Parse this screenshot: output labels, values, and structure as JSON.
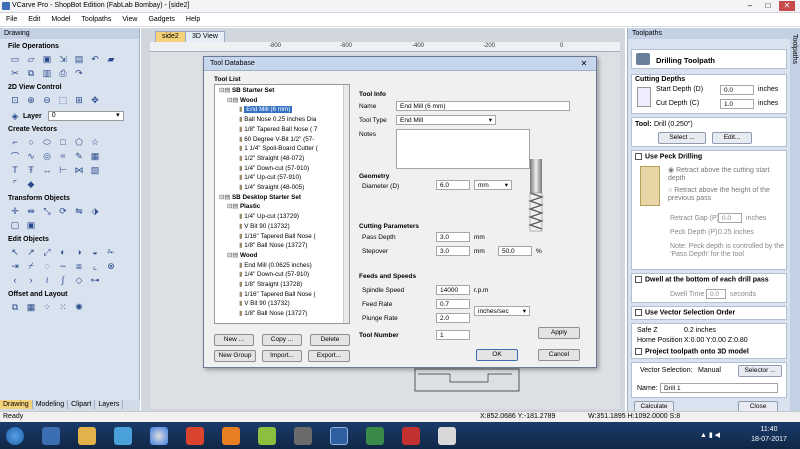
{
  "window": {
    "title": "VCarve Pro - ShopBot Edition (FabLab Bombay) - [side2]"
  },
  "menu": [
    "File",
    "Edit",
    "Model",
    "Toolpaths",
    "View",
    "Gadgets",
    "Help"
  ],
  "left_panel": {
    "header": "Drawing",
    "sections": {
      "file_ops": "File Operations",
      "view_control": "2D View Control",
      "layer_label": "Layer",
      "layer_value": "0",
      "create_vectors": "Create Vectors",
      "transform": "Transform Objects",
      "edit_objects": "Edit Objects",
      "offset": "Offset and Layout"
    },
    "tabs": [
      "Drawing",
      "Modeling",
      "Clipart",
      "Layers"
    ]
  },
  "doc_tabs": [
    "side2",
    "3D View"
  ],
  "ruler": [
    "-800",
    "-600",
    "-400",
    "-200",
    "0"
  ],
  "dialog": {
    "title": "Tool Database",
    "tool_list_label": "Tool List",
    "tree": [
      {
        "t": "SB Starter Set",
        "bold": true
      },
      {
        "t": "Wood",
        "bold": true
      },
      {
        "t": "End Mill (6 mm)",
        "sel": true
      },
      {
        "t": "Ball Nose 0.25 inches Dia"
      },
      {
        "t": "1/8\" Tapered Ball Nose ( 7"
      },
      {
        "t": "60 Degree V-Bit 1/2\" (57-"
      },
      {
        "t": "1 1/4\" Spoil-Board Cutter ("
      },
      {
        "t": "1/2\" Straight  (48-072)"
      },
      {
        "t": "1/4\" Down-cut (57-910)"
      },
      {
        "t": "1/4\" Up-cut (57-910)"
      },
      {
        "t": "1/4\" Straight (48-005)"
      },
      {
        "t": "SB Desktop Starter Set",
        "bold": true
      },
      {
        "t": "Plastic",
        "bold": true
      },
      {
        "t": "1/4\" Up-cut (13729)"
      },
      {
        "t": "V Bit 90 (13732)"
      },
      {
        "t": "1/16\" Tapered Ball Nose ("
      },
      {
        "t": "1/8\" Ball Nose (13727)"
      },
      {
        "t": "Wood",
        "bold": true
      },
      {
        "t": "End Mill (0.0625 inches)"
      },
      {
        "t": "1/4\" Down-cut (57-910)"
      },
      {
        "t": "1/8\" Straight (13728)"
      },
      {
        "t": "1/16\" Tapered Ball Nose ("
      },
      {
        "t": "V Bit 90 (13732)"
      },
      {
        "t": "1/8\" Ball Nose (13727)"
      }
    ],
    "buttons": {
      "new": "New ...",
      "copy": "Copy ...",
      "delete": "Delete",
      "new_group": "New Group",
      "import": "Import...",
      "export": "Export...",
      "apply": "Apply",
      "ok": "OK",
      "cancel": "Cancel"
    },
    "tool_info": {
      "header": "Tool Info",
      "name_label": "Name",
      "name": "End Mill (6 mm)",
      "type_label": "Tool Type",
      "type": "End Mill",
      "notes_label": "Notes"
    },
    "geometry": {
      "header": "Geometry",
      "diameter_label": "Diameter (D)",
      "diameter": "6.0",
      "unit": "mm"
    },
    "cutting": {
      "header": "Cutting Parameters",
      "pass_depth_label": "Pass Depth",
      "pass_depth": "3.0",
      "stepover_label": "Stepover",
      "stepover": "3.0",
      "stepover_pct": "50.0",
      "mm": "mm",
      "pct": "%"
    },
    "feeds": {
      "header": "Feeds and Speeds",
      "spindle_label": "Spindle Speed",
      "spindle": "14000",
      "rpm": "r.p.m",
      "feed_label": "Feed Rate",
      "feed": "0.7",
      "plunge_label": "Plunge Rate",
      "plunge": "2.0",
      "rate_unit": "inches/sec",
      "tool_number_label": "Tool Number",
      "tool_number": "1"
    }
  },
  "right_panel": {
    "header": "Toolpaths",
    "title": "Drilling Toolpath",
    "cutting_depths": "Cutting Depths",
    "start_depth_label": "Start Depth (D)",
    "start_depth": "0.0",
    "end_depth_label": "Cut Depth (C)",
    "cut_depth": "1.0",
    "units": "inches",
    "tool_label": "Tool:",
    "tool_value": "Drill (0.250\")",
    "select": "Select ...",
    "edit": "Edit...",
    "peck": "Use Peck Drilling",
    "retract1": "Retract above the cutting start depth",
    "retract2": "Retract above the height of the previous pass",
    "retract_gap_label": "Retract Gap (P)",
    "retract_gap": "0.0",
    "peck_depth_label": "Peck Depth (P)",
    "peck_depth": "0.25 inches",
    "note": "Note: Peck depth is controlled by the 'Pass Depth' for the tool",
    "dwell": "Dwell at the bottom of each drill pass",
    "dwell_time_label": "Dwell Time",
    "dwell_time": "0.0",
    "seconds": "seconds",
    "vector_sel_order": "Use Vector Selection Order",
    "safe_z_label": "Safe Z",
    "safe_z": "0.2 inches",
    "home_label": "Home Position",
    "home": "X:0.00 Y:0.00 Z:0.80",
    "project": "Project toolpath onto 3D model",
    "vector_selection_label": "Vector Selection:",
    "vector_selection": "Manual",
    "selector": "Selector ...",
    "name_label": "Name:",
    "name": "Drill 1",
    "calculate": "Calculate",
    "close": "Close",
    "strip": "Toolpaths"
  },
  "status": {
    "ready": "Ready",
    "coords": "X:852.0686 Y:-181.2789",
    "dims": "W:351.1895  H:1092.0000  S:8"
  },
  "taskbar": {
    "time": "11:40",
    "date": "18-07-2017"
  }
}
